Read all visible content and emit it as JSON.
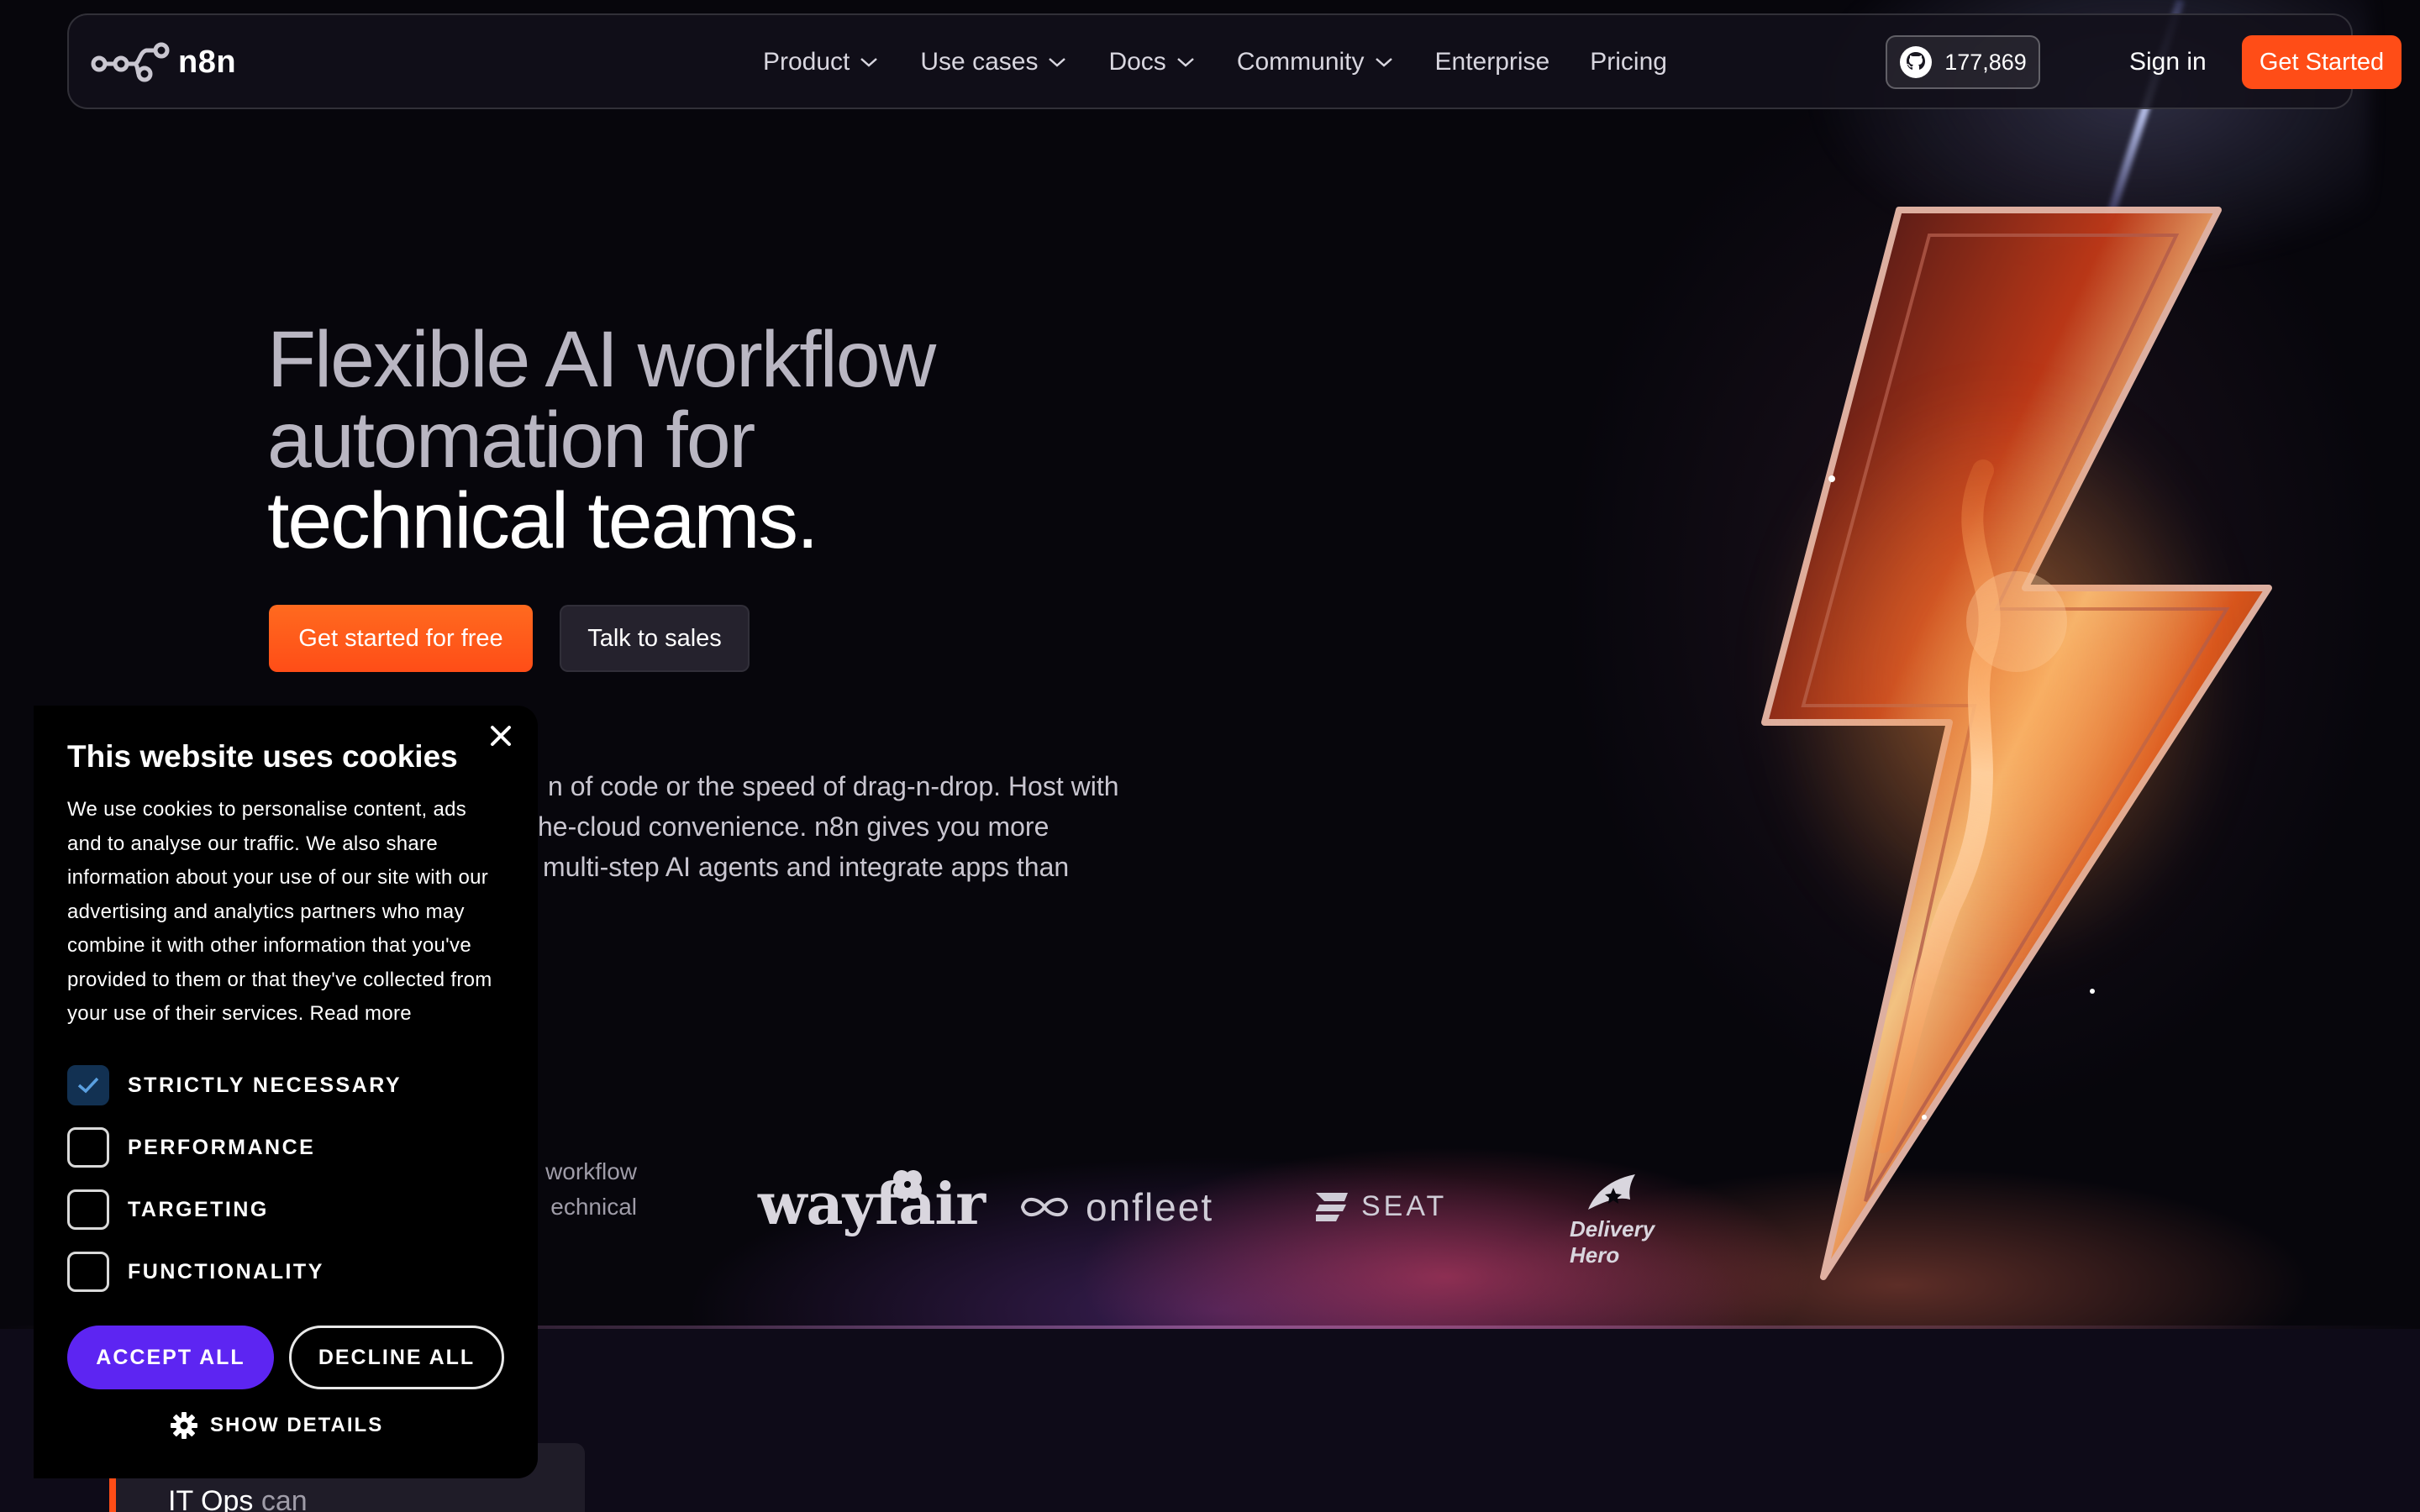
{
  "nav": {
    "brand": "n8n",
    "items": [
      {
        "label": "Product",
        "dropdown": true
      },
      {
        "label": "Use cases",
        "dropdown": true
      },
      {
        "label": "Docs",
        "dropdown": true
      },
      {
        "label": "Community",
        "dropdown": true
      },
      {
        "label": "Enterprise",
        "dropdown": false
      },
      {
        "label": "Pricing",
        "dropdown": false
      }
    ],
    "github_stars": "177,869",
    "signin_label": "Sign in",
    "cta_label": "Get Started"
  },
  "hero": {
    "title_line1": "Flexible AI workflow",
    "title_line2": "automation for",
    "title_line3": "technical teams.",
    "primary_cta": "Get started for free",
    "secondary_cta": "Talk to sales",
    "subtitle_line1": "n of code or the speed of drag-n-drop. Host with",
    "subtitle_line2": "he-cloud convenience. n8n gives you more",
    "subtitle_line3": "multi-step AI agents and integrate apps than",
    "trusted_line1": "workflow",
    "trusted_line2": "echnical"
  },
  "logos": {
    "wayfair": "wayfair",
    "onfleet": "onfleet",
    "seat": "SEAT",
    "delivery_hero": "Delivery Hero"
  },
  "cookie_banner": {
    "title": "This website uses cookies",
    "body": "We use cookies to personalise content, ads and to analyse our traffic. We also share information about your use of our site with our advertising and analytics partners who may combine it with other information that you've provided to them or that they've collected from your use of their services.",
    "read_more": "Read more",
    "options": [
      {
        "label": "STRICTLY NECESSARY",
        "checked": true
      },
      {
        "label": "PERFORMANCE",
        "checked": false
      },
      {
        "label": "TARGETING",
        "checked": false
      },
      {
        "label": "FUNCTIONALITY",
        "checked": false
      }
    ],
    "accept_label": "ACCEPT ALL",
    "decline_label": "DECLINE ALL",
    "details_label": "SHOW DETAILS"
  },
  "below": {
    "card_title": "IT Ops",
    "card_rest": "can"
  },
  "colors": {
    "accent_orange": "#ff4d17",
    "accept_purple": "#5d25f2",
    "background": "#0e0b18"
  },
  "icons": [
    "n8n-logo-icon",
    "chevron-down-icon",
    "github-icon",
    "close-icon",
    "checkmark-icon",
    "gear-icon",
    "lightning-bolt-icon"
  ]
}
